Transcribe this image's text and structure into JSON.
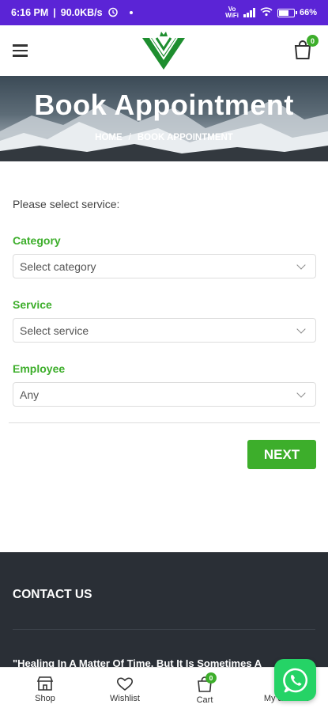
{
  "status_bar": {
    "time": "6:16 PM",
    "net_speed": "90.0KB/s",
    "battery": "66%",
    "volte1": "Vo",
    "volte2": "WiFi"
  },
  "header": {
    "cart_count": "0"
  },
  "hero": {
    "title": "Book Appointment",
    "breadcrumb_home": "HOME",
    "breadcrumb_sep": "/",
    "breadcrumb_current": "BOOK APPOINTMENT"
  },
  "form": {
    "intro": "Please select service:",
    "category_label": "Category",
    "category_value": "Select category",
    "service_label": "Service",
    "service_value": "Select service",
    "employee_label": "Employee",
    "employee_value": "Any",
    "next_label": "NEXT"
  },
  "footer": {
    "title": "CONTACT US",
    "quote": "\"Healing In A Matter Of Time, But It Is Sometimes A"
  },
  "bottom_nav": {
    "items": [
      {
        "label": "Shop",
        "icon": "store-icon"
      },
      {
        "label": "Wishlist",
        "icon": "heart-icon"
      },
      {
        "label": "Cart",
        "icon": "shopping-bag-icon"
      },
      {
        "label": "My account",
        "icon": "user-icon"
      }
    ],
    "cart_count": "0"
  },
  "colors": {
    "accent": "#3dae2b",
    "status_bar": "#5b24d6",
    "footer": "#2a2f36",
    "whatsapp": "#25d366"
  }
}
